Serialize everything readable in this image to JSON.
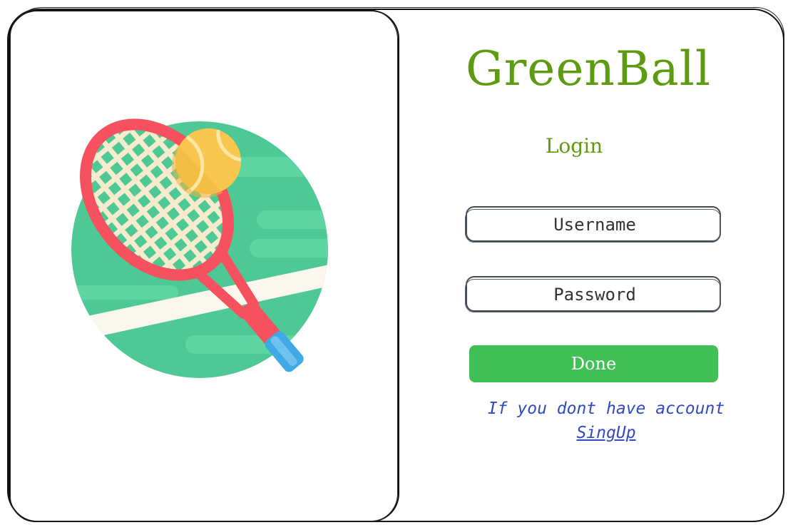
{
  "brand": {
    "title": "GreenBall"
  },
  "login": {
    "heading": "Login",
    "username": {
      "placeholder": "Username",
      "value": ""
    },
    "password": {
      "placeholder": "Password",
      "value": ""
    },
    "submit_label": "Done",
    "signup_hint": "If you dont have account",
    "signup_link": "SingUp"
  },
  "illustration": {
    "icon": "tennis-racket-and-ball-icon"
  },
  "colors": {
    "brand_green": "#5d9b10",
    "button_green": "#40c057",
    "link_blue": "#3049c8",
    "court_green": "#4ec995",
    "racket_red": "#f5515f",
    "ball_yellow": "#f9c74f"
  }
}
